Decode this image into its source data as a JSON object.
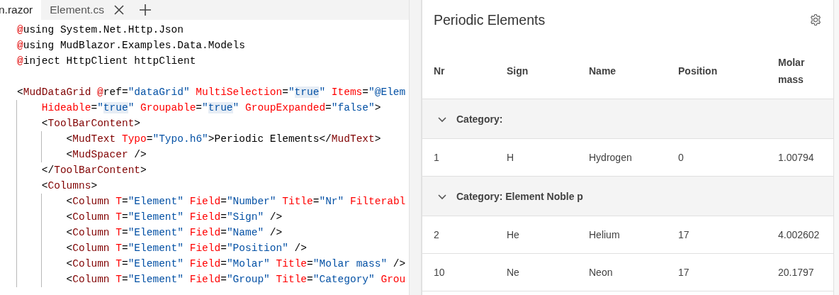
{
  "editor": {
    "tabs": [
      {
        "label": "n.razor",
        "selected": true,
        "close_button": false
      },
      {
        "label": "Element.cs",
        "selected": false,
        "close_button": true
      }
    ],
    "lines": [
      {
        "kind": "code",
        "tokens": [
          {
            "kind": "directive",
            "text": "@"
          },
          {
            "kind": "plain",
            "text": "using System.Net.Http.Json"
          }
        ]
      },
      {
        "kind": "code",
        "tokens": [
          {
            "kind": "directive",
            "text": "@"
          },
          {
            "kind": "plain",
            "text": "using MudBlazor.Examples.Data.Models"
          }
        ]
      },
      {
        "kind": "code",
        "tokens": [
          {
            "kind": "directive",
            "text": "@"
          },
          {
            "kind": "plain",
            "text": "inject HttpClient httpClient"
          }
        ]
      },
      {
        "kind": "blank"
      },
      {
        "kind": "code",
        "tokens": [
          {
            "kind": "plain",
            "text": "<"
          },
          {
            "kind": "tag",
            "text": "MudDataGrid"
          },
          {
            "kind": "directive",
            "text": " @"
          },
          {
            "kind": "plain",
            "text": "ref="
          },
          {
            "kind": "value",
            "text": "\"dataGrid\""
          },
          {
            "kind": "attr",
            "text": " MultiSelection"
          },
          {
            "kind": "plain",
            "text": "="
          },
          {
            "kind": "value",
            "text": "\""
          },
          {
            "kind": "highlighted-value",
            "text": "true"
          },
          {
            "kind": "value",
            "text": "\""
          },
          {
            "kind": "attr",
            "text": " Items"
          },
          {
            "kind": "plain",
            "text": "="
          },
          {
            "kind": "value",
            "text": "\"@Elem"
          }
        ]
      },
      {
        "kind": "code",
        "tokens": [
          {
            "kind": "attr",
            "text": "    Hideable"
          },
          {
            "kind": "plain",
            "text": "="
          },
          {
            "kind": "value",
            "text": "\""
          },
          {
            "kind": "highlighted-value",
            "text": "true"
          },
          {
            "kind": "value",
            "text": "\""
          },
          {
            "kind": "attr",
            "text": " Groupable"
          },
          {
            "kind": "plain",
            "text": "="
          },
          {
            "kind": "value",
            "text": "\""
          },
          {
            "kind": "highlighted-value",
            "text": "true"
          },
          {
            "kind": "value",
            "text": "\""
          },
          {
            "kind": "attr",
            "text": " GroupExpanded"
          },
          {
            "kind": "plain",
            "text": "="
          },
          {
            "kind": "value",
            "text": "\"false\""
          },
          {
            "kind": "plain",
            "text": ">"
          }
        ]
      },
      {
        "kind": "code",
        "tokens": [
          {
            "kind": "plain",
            "text": "    <"
          },
          {
            "kind": "tag",
            "text": "ToolBarContent"
          },
          {
            "kind": "plain",
            "text": ">"
          }
        ]
      },
      {
        "kind": "code",
        "tokens": [
          {
            "kind": "plain",
            "text": "        <"
          },
          {
            "kind": "tag",
            "text": "MudText"
          },
          {
            "kind": "attr",
            "text": " Typo"
          },
          {
            "kind": "plain",
            "text": "="
          },
          {
            "kind": "value",
            "text": "\"Typo.h6\""
          },
          {
            "kind": "plain",
            "text": ">Periodic Elements</"
          },
          {
            "kind": "tag",
            "text": "MudText"
          },
          {
            "kind": "plain",
            "text": ">"
          }
        ]
      },
      {
        "kind": "code",
        "tokens": [
          {
            "kind": "plain",
            "text": "        <"
          },
          {
            "kind": "tag",
            "text": "MudSpacer"
          },
          {
            "kind": "plain",
            "text": " />"
          }
        ]
      },
      {
        "kind": "code",
        "tokens": [
          {
            "kind": "plain",
            "text": "    </"
          },
          {
            "kind": "tag",
            "text": "ToolBarContent"
          },
          {
            "kind": "plain",
            "text": ">"
          }
        ]
      },
      {
        "kind": "code",
        "tokens": [
          {
            "kind": "plain",
            "text": "    <"
          },
          {
            "kind": "tag",
            "text": "Columns"
          },
          {
            "kind": "plain",
            "text": ">"
          }
        ]
      },
      {
        "kind": "code",
        "tokens": [
          {
            "kind": "plain",
            "text": "        <"
          },
          {
            "kind": "tag",
            "text": "Column"
          },
          {
            "kind": "attr",
            "text": " T"
          },
          {
            "kind": "plain",
            "text": "="
          },
          {
            "kind": "value",
            "text": "\"Element\""
          },
          {
            "kind": "attr",
            "text": " Field"
          },
          {
            "kind": "plain",
            "text": "="
          },
          {
            "kind": "value",
            "text": "\"Number\""
          },
          {
            "kind": "attr",
            "text": " Title"
          },
          {
            "kind": "plain",
            "text": "="
          },
          {
            "kind": "value",
            "text": "\"Nr\""
          },
          {
            "kind": "attr",
            "text": " Filterabl"
          }
        ]
      },
      {
        "kind": "code",
        "tokens": [
          {
            "kind": "plain",
            "text": "        <"
          },
          {
            "kind": "tag",
            "text": "Column"
          },
          {
            "kind": "attr",
            "text": " T"
          },
          {
            "kind": "plain",
            "text": "="
          },
          {
            "kind": "value",
            "text": "\"Element\""
          },
          {
            "kind": "attr",
            "text": " Field"
          },
          {
            "kind": "plain",
            "text": "="
          },
          {
            "kind": "value",
            "text": "\"Sign\""
          },
          {
            "kind": "plain",
            "text": " />"
          }
        ]
      },
      {
        "kind": "code",
        "tokens": [
          {
            "kind": "plain",
            "text": "        <"
          },
          {
            "kind": "tag",
            "text": "Column"
          },
          {
            "kind": "attr",
            "text": " T"
          },
          {
            "kind": "plain",
            "text": "="
          },
          {
            "kind": "value",
            "text": "\"Element\""
          },
          {
            "kind": "attr",
            "text": " Field"
          },
          {
            "kind": "plain",
            "text": "="
          },
          {
            "kind": "value",
            "text": "\"Name\""
          },
          {
            "kind": "plain",
            "text": " />"
          }
        ]
      },
      {
        "kind": "code",
        "tokens": [
          {
            "kind": "plain",
            "text": "        <"
          },
          {
            "kind": "tag",
            "text": "Column"
          },
          {
            "kind": "attr",
            "text": " T"
          },
          {
            "kind": "plain",
            "text": "="
          },
          {
            "kind": "value",
            "text": "\"Element\""
          },
          {
            "kind": "attr",
            "text": " Field"
          },
          {
            "kind": "plain",
            "text": "="
          },
          {
            "kind": "value",
            "text": "\"Position\""
          },
          {
            "kind": "plain",
            "text": " />"
          }
        ]
      },
      {
        "kind": "code",
        "tokens": [
          {
            "kind": "plain",
            "text": "        <"
          },
          {
            "kind": "tag",
            "text": "Column"
          },
          {
            "kind": "attr",
            "text": " T"
          },
          {
            "kind": "plain",
            "text": "="
          },
          {
            "kind": "value",
            "text": "\"Element\""
          },
          {
            "kind": "attr",
            "text": " Field"
          },
          {
            "kind": "plain",
            "text": "="
          },
          {
            "kind": "value",
            "text": "\"Molar\""
          },
          {
            "kind": "attr",
            "text": " Title"
          },
          {
            "kind": "plain",
            "text": "="
          },
          {
            "kind": "value",
            "text": "\"Molar mass\""
          },
          {
            "kind": "plain",
            "text": " />"
          }
        ]
      },
      {
        "kind": "code",
        "tokens": [
          {
            "kind": "plain",
            "text": "        <"
          },
          {
            "kind": "tag",
            "text": "Column"
          },
          {
            "kind": "attr",
            "text": " T"
          },
          {
            "kind": "plain",
            "text": "="
          },
          {
            "kind": "value",
            "text": "\"Element\""
          },
          {
            "kind": "attr",
            "text": " Field"
          },
          {
            "kind": "plain",
            "text": "="
          },
          {
            "kind": "value",
            "text": "\"Group\""
          },
          {
            "kind": "attr",
            "text": " Title"
          },
          {
            "kind": "plain",
            "text": "="
          },
          {
            "kind": "value",
            "text": "\"Category\""
          },
          {
            "kind": "attr",
            "text": " Grou"
          }
        ]
      }
    ]
  },
  "data_grid": {
    "title": "Periodic Elements",
    "columns": [
      "Nr",
      "Sign",
      "Name",
      "Position",
      "Molar mass"
    ],
    "groups": [
      {
        "label": "Category:",
        "expanded": true,
        "rows": [
          {
            "cells": [
              "1",
              "H",
              "Hydrogen",
              "0",
              "1.00794"
            ]
          }
        ]
      },
      {
        "label": "Category: Element Noble p",
        "expanded": true,
        "rows": [
          {
            "cells": [
              "2",
              "He",
              "Helium",
              "17",
              "4.002602"
            ]
          },
          {
            "cells": [
              "10",
              "Ne",
              "Neon",
              "17",
              "20.1797"
            ]
          }
        ]
      }
    ]
  }
}
